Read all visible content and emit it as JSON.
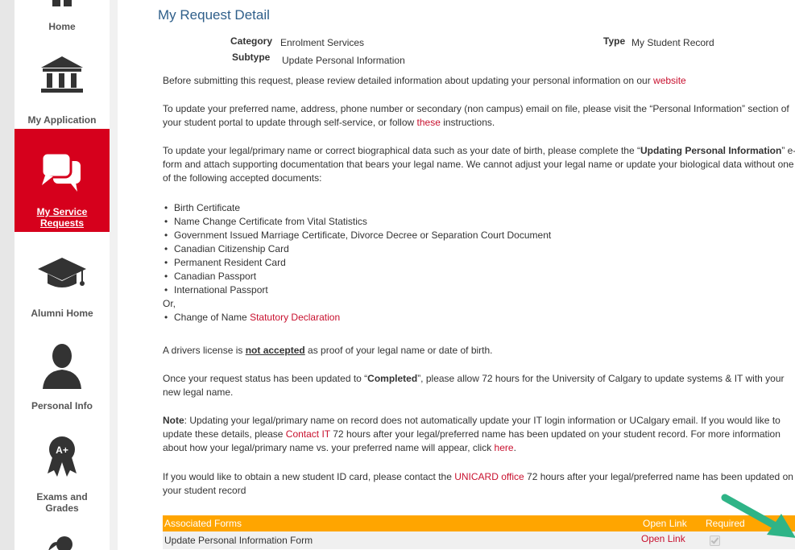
{
  "sidebar": {
    "items": [
      {
        "label": "Home",
        "icon": "home-icon"
      },
      {
        "label": "My Application",
        "icon": "institution-icon"
      },
      {
        "label": "My Service Requests",
        "icon": "chat-bubbles-icon",
        "active": true
      },
      {
        "label": "Alumni Home",
        "icon": "graduation-cap-icon"
      },
      {
        "label": "Personal Info",
        "icon": "person-icon"
      },
      {
        "label": "Exams and Grades",
        "icon": "award-ribbon-icon"
      }
    ]
  },
  "colors": {
    "accent_red": "#d6001c",
    "link_red": "#c8102e",
    "title_blue": "#2f5f8a",
    "table_header": "#ffa500"
  },
  "request": {
    "title": "My Request Detail",
    "category_label": "Category",
    "category_value": "Enrolment Services",
    "type_label": "Type",
    "type_value": "My Student Record",
    "subtype_label": "Subtype",
    "subtype_value": "Update Personal Information"
  },
  "content": {
    "p1_text": "Before submitting this request, please review detailed information about updating your personal information on our ",
    "p1_link": "website",
    "p2_text": "To update your preferred name, address, phone number or secondary (non campus) email on file, please visit the “Personal Information” section of your student portal to update through self-service, or follow ",
    "p2_link": "these",
    "p2_after": " instructions.",
    "p3_before": "To update your legal/primary name or correct biographical data such as your date of birth, please complete the “",
    "p3_bold": "Updating Personal Information",
    "p3_after": "” e-form and attach supporting documentation that bears your legal name. We cannot adjust your legal name or update your biological data without one of the following accepted documents:",
    "documents": [
      "Birth Certificate",
      "Name Change Certificate from Vital Statistics",
      "Government Issued Marriage Certificate, Divorce Decree or Separation Court Document",
      "Canadian Citizenship Card",
      "Permanent Resident Card",
      "Canadian Passport",
      "International Passport"
    ],
    "or_text": "Or,",
    "change_name_text": "Change of Name ",
    "change_name_link": "Statutory Declaration",
    "p4_before": "A drivers license is ",
    "p4_emph": "not accepted",
    "p4_after": " as proof of your legal name or date of birth.",
    "p5_before": "Once your request status has been updated to “",
    "p5_bold": "Completed",
    "p5_after": "”, please allow 72 hours for the University of Calgary to update systems & IT with your new legal name.",
    "p6_note": "Note",
    "p6_text1": ": Updating your legal/primary name on record does not automatically update your IT login information or UCalgary email. If you would like to update these details, please ",
    "p6_link1": "Contact IT",
    "p6_text2": " 72 hours after your legal/preferred name has been updated on your student record. For more information about how your legal/primary name vs. your preferred name will appear, click ",
    "p6_link2": "here",
    "p6_text3": ".",
    "p7_before": "If you would like to obtain a new student ID card, please contact the ",
    "p7_link": "UNICARD office",
    "p7_after": " 72 hours after your legal/preferred name has been updated on your student record"
  },
  "forms_table": {
    "headers": [
      "Associated Forms",
      "Open Link",
      "Required"
    ],
    "rows": [
      {
        "form": "Update Personal Information Form",
        "link": "Open Link",
        "required": true
      }
    ]
  }
}
